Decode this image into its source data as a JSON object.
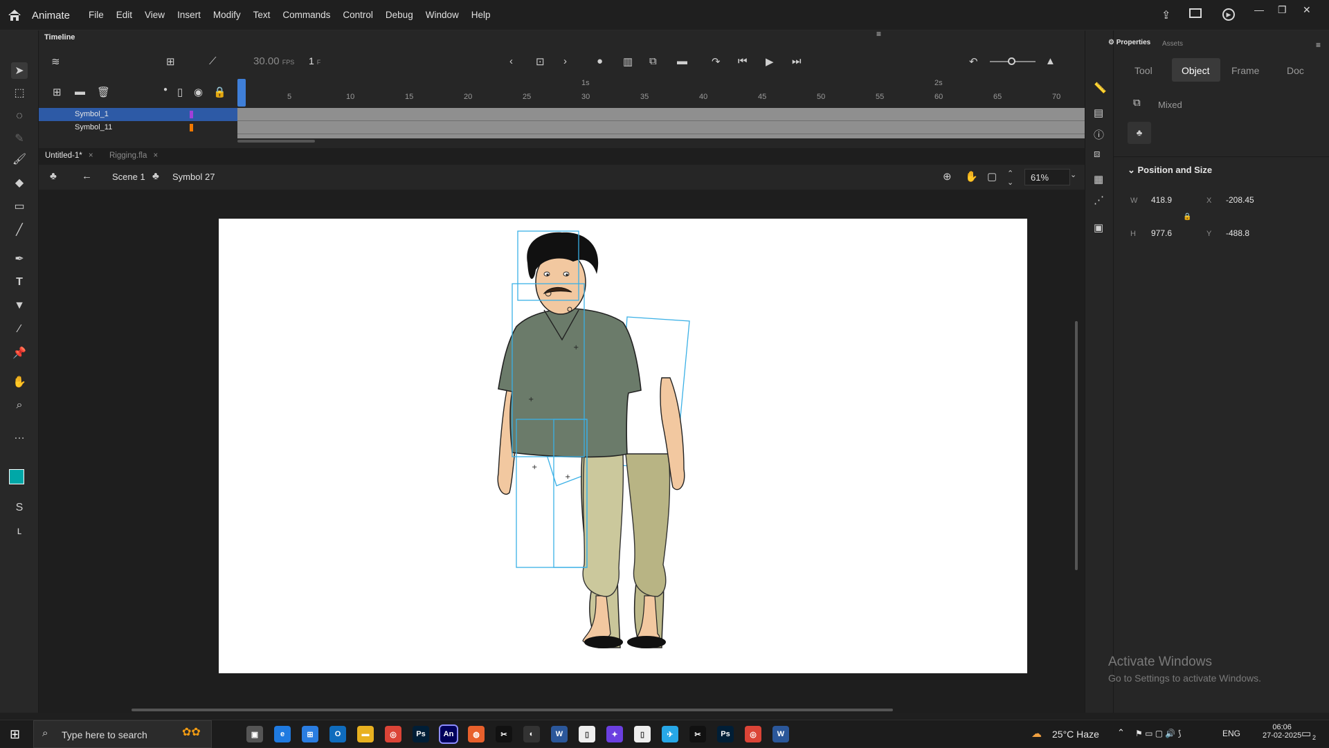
{
  "app": {
    "name": "Animate",
    "menus": [
      "File",
      "Edit",
      "View",
      "Insert",
      "Modify",
      "Text",
      "Commands",
      "Control",
      "Debug",
      "Window",
      "Help"
    ]
  },
  "timeline": {
    "title": "Timeline",
    "fps": "30.00",
    "fps_unit": "FPS",
    "frame": "1",
    "frame_unit": "F",
    "ruler_ticks": [
      "5",
      "10",
      "15",
      "20",
      "25",
      "30",
      "35",
      "40",
      "45",
      "50",
      "55",
      "60",
      "65",
      "70"
    ],
    "ruler_seconds": [
      "1s",
      "2s"
    ],
    "layers": [
      {
        "name": "Symbol_1",
        "color": "#a040d8",
        "selected": true
      },
      {
        "name": "Symbol_11",
        "color": "#f07800",
        "selected": false
      }
    ]
  },
  "tabs": [
    {
      "label": "Untitled-1*",
      "active": true
    },
    {
      "label": "Rigging.fla",
      "active": false
    }
  ],
  "editbar": {
    "scene": "Scene 1",
    "symbol": "Symbol 27",
    "zoom": "61%"
  },
  "properties": {
    "tabs_header": [
      "Properties",
      "Assets"
    ],
    "tabs": [
      "Tool",
      "Object",
      "Frame",
      "Doc"
    ],
    "active_tab": "Object",
    "selection": "Mixed",
    "section": "Position and Size",
    "w_label": "W",
    "w": "418.9",
    "x_label": "X",
    "x": "-208.45",
    "h_label": "H",
    "h": "977.6",
    "y_label": "Y",
    "y": "-488.8"
  },
  "watermark": {
    "line1": "Activate Windows",
    "line2": "Go to Settings to activate Windows."
  },
  "taskbar": {
    "search_placeholder": "Type here to search",
    "weather": "25°C  Haze",
    "lang": "ENG",
    "time": "06:06",
    "date": "27-02-2025",
    "notifications": "2",
    "apps": [
      "task-view",
      "edge",
      "store",
      "outlook",
      "file-explorer",
      "chrome",
      "photoshop",
      "animate",
      "app-generic",
      "capcut",
      "obs",
      "word",
      "file",
      "copilot",
      "file2",
      "telegram",
      "capcut2",
      "photoshop2",
      "chrome2",
      "word2"
    ]
  },
  "colors": {
    "accent": "#1473e6",
    "fill_color": "#00a7a7",
    "stroke_color": "#f5e63c",
    "selection_outline": "#3ab0e6"
  }
}
